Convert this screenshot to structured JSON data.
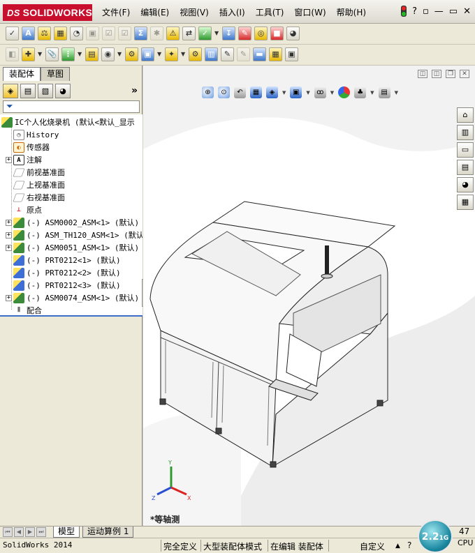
{
  "app": {
    "logo_text": "SOLIDWORKS",
    "logo_mark": "DS"
  },
  "menu": [
    "文件(F)",
    "编辑(E)",
    "视图(V)",
    "插入(I)",
    "工具(T)",
    "窗口(W)",
    "帮助(H)"
  ],
  "window_controls": {
    "help": "?",
    "pin": "▫",
    "minimize": "—",
    "restore": "▭",
    "close": "✕"
  },
  "left_panel": {
    "tabs": [
      "装配体",
      "草图"
    ],
    "more": "»",
    "filter_icon": "funnel-icon"
  },
  "tree": {
    "root": "IC个人化烧录机  (默认<默认_显示",
    "items": [
      {
        "label": "History",
        "icon": "history-icon",
        "expand": false
      },
      {
        "label": "传感器",
        "icon": "sensor-icon",
        "expand": false
      },
      {
        "label": "注解",
        "icon": "annotation-icon",
        "expand": true
      },
      {
        "label": "前视基准面",
        "icon": "plane-icon",
        "expand": false
      },
      {
        "label": "上视基准面",
        "icon": "plane-icon",
        "expand": false
      },
      {
        "label": "右视基准面",
        "icon": "plane-icon",
        "expand": false
      },
      {
        "label": "原点",
        "icon": "origin-icon",
        "expand": false
      },
      {
        "label": "(-) ASM0002_ASM<1> (默认)",
        "icon": "assembly-icon",
        "expand": true
      },
      {
        "label": "(-) ASM_TH120_ASM<1> (默认)",
        "icon": "assembly-icon",
        "expand": true
      },
      {
        "label": "(-) ASM0051_ASM<1> (默认)",
        "icon": "assembly-icon",
        "expand": true
      },
      {
        "label": "(-) PRT0212<1> (默认)",
        "icon": "part-icon",
        "expand": false
      },
      {
        "label": "(-) PRT0212<2> (默认)",
        "icon": "part-icon",
        "expand": false
      },
      {
        "label": "(-) PRT0212<3> (默认)",
        "icon": "part-icon",
        "expand": false
      },
      {
        "label": "(-) ASM0074_ASM<1> (默认)",
        "icon": "assembly-icon",
        "expand": true
      },
      {
        "label": "配合",
        "icon": "mates-icon",
        "expand": false
      }
    ]
  },
  "viewport": {
    "view_name": "*等轴测",
    "triad": {
      "x": "X",
      "y": "Y",
      "z": "Z"
    }
  },
  "bottom_tabs": [
    "模型",
    "运动算例 1"
  ],
  "status": {
    "product": "SolidWorks 2014",
    "definition": "完全定义",
    "mode": "大型装配体模式",
    "editing": "在编辑 装配体",
    "custom": "自定义",
    "help": "?"
  },
  "clock": {
    "value": "2.2",
    "unit": "1G"
  },
  "cpu": {
    "value": "47",
    "label": "CPU"
  }
}
